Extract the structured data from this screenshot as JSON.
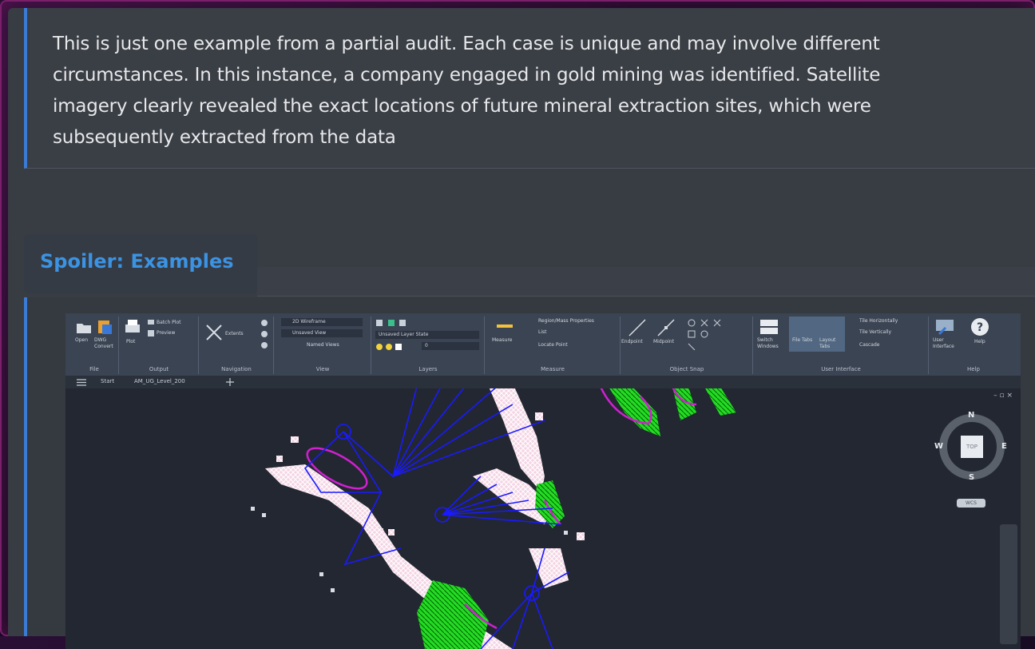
{
  "quote": {
    "text": "This is just one example from a partial audit. Each case is unique and may involve different circumstances. In this instance, a company engaged in gold mining was identified. Satellite imagery clearly revealed the exact locations of future mineral extraction sites, which were subsequently extracted from the data"
  },
  "spoiler": {
    "label": "Spoiler: Examples"
  },
  "cad": {
    "ribbon_groups": [
      {
        "id": "file",
        "title": "File"
      },
      {
        "id": "output",
        "title": "Output"
      },
      {
        "id": "navigation",
        "title": "Navigation"
      },
      {
        "id": "view",
        "title": "View"
      },
      {
        "id": "layers",
        "title": "Layers"
      },
      {
        "id": "measure",
        "title": "Measure"
      },
      {
        "id": "object_snap",
        "title": "Object Snap"
      },
      {
        "id": "user_interface",
        "title": "User Interface"
      },
      {
        "id": "help",
        "title": "Help"
      }
    ],
    "items": {
      "open": "Open",
      "dwg_convert": "DWG Convert",
      "plot": "Plot",
      "batch_plot": "Batch Plot",
      "preview": "Preview",
      "extents": "Extents",
      "visual_style": "2D Wireframe",
      "view_preset": "Unsaved View",
      "named_views": "Named Views",
      "layer_state": "Unsaved Layer State",
      "layer_value": "0",
      "measure": "Measure",
      "region_mass": "Region/Mass Properties",
      "list": "List",
      "locate_point": "Locate Point",
      "endpoint": "Endpoint",
      "midpoint": "Midpoint",
      "switch_windows": "Switch Windows",
      "file_tabs": "File Tabs",
      "layout_tabs": "Layout Tabs",
      "tile_horizontally": "Tile Horizontally",
      "tile_vertically": "Tile Vertically",
      "cascade": "Cascade",
      "user_interface": "User Interface",
      "help": "Help"
    },
    "tabs": {
      "start": "Start",
      "drawing": "AM_UG_Level_200"
    },
    "viewcube": {
      "n": "N",
      "s": "S",
      "e": "E",
      "w": "W",
      "top": "TOP",
      "wcs": "WCS"
    }
  },
  "colors": {
    "accent": "#3a7bd5",
    "spoiler_link": "#3b93e3",
    "cad_background": "#222731",
    "polyline_blue": "#1a1aff",
    "magenta": "#d020d0",
    "green": "#22dd22"
  }
}
